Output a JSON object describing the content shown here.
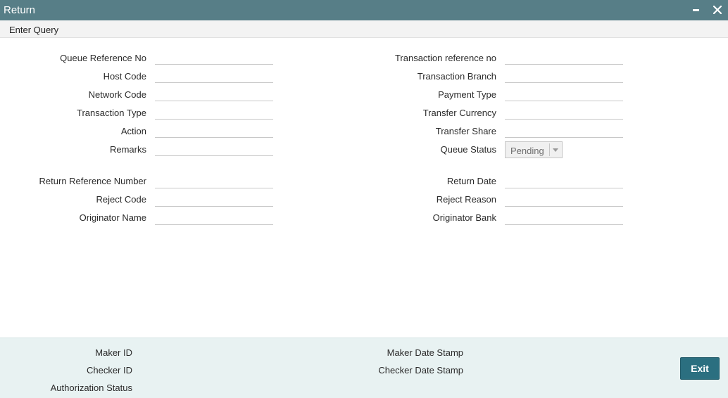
{
  "window": {
    "title": "Return"
  },
  "menu": {
    "enter_query": "Enter Query"
  },
  "form": {
    "left": [
      {
        "label": "Queue Reference No",
        "value": ""
      },
      {
        "label": "Host Code",
        "value": ""
      },
      {
        "label": "Network Code",
        "value": ""
      },
      {
        "label": "Transaction Type",
        "value": ""
      },
      {
        "label": "Action",
        "value": ""
      },
      {
        "label": "Remarks",
        "value": ""
      },
      {
        "label": "Return Reference Number",
        "value": ""
      },
      {
        "label": "Reject Code",
        "value": ""
      },
      {
        "label": "Originator Name",
        "value": ""
      }
    ],
    "right": [
      {
        "label": "Transaction reference no",
        "value": ""
      },
      {
        "label": "Transaction Branch",
        "value": ""
      },
      {
        "label": "Payment Type",
        "value": ""
      },
      {
        "label": "Transfer Currency",
        "value": ""
      },
      {
        "label": "Transfer Share",
        "value": ""
      },
      {
        "label": "Queue Status",
        "value": "Pending"
      },
      {
        "label": "Return Date",
        "value": ""
      },
      {
        "label": "Reject Reason",
        "value": ""
      },
      {
        "label": "Originator Bank",
        "value": ""
      }
    ]
  },
  "footer": {
    "maker_id": "Maker ID",
    "checker_id": "Checker ID",
    "authorization_status": "Authorization Status",
    "maker_date_stamp": "Maker Date Stamp",
    "checker_date_stamp": "Checker Date Stamp",
    "exit_label": "Exit"
  },
  "colors": {
    "titlebar": "#577e87",
    "footer": "#e8f2f2",
    "exit_button": "#2b6f80"
  }
}
